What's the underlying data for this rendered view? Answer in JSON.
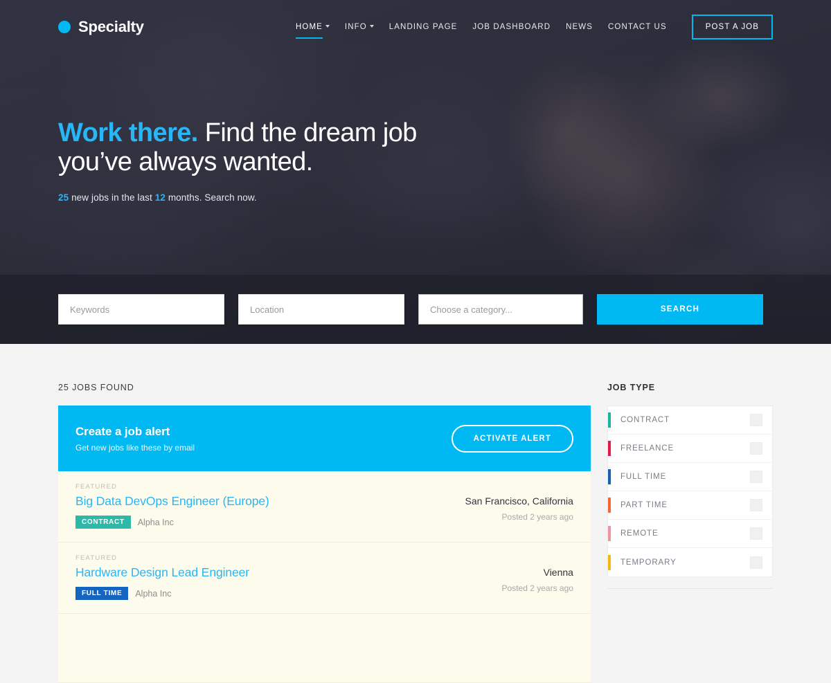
{
  "header": {
    "logo_text": "Specialty",
    "nav": [
      {
        "label": "HOME",
        "has_caret": true,
        "active": true
      },
      {
        "label": "INFO",
        "has_caret": true,
        "active": false
      },
      {
        "label": "LANDING PAGE",
        "has_caret": false,
        "active": false
      },
      {
        "label": "JOB DASHBOARD",
        "has_caret": false,
        "active": false
      },
      {
        "label": "NEWS",
        "has_caret": false,
        "active": false
      },
      {
        "label": "CONTACT US",
        "has_caret": false,
        "active": false
      }
    ],
    "post_job_label": "POST A JOB"
  },
  "hero": {
    "title_accent": "Work there.",
    "title_rest": " Find the dream job you’ve always wanted.",
    "sub_count": "25",
    "sub_mid": " new jobs in the last ",
    "sub_months": "12",
    "sub_end": " months. Search now."
  },
  "search": {
    "keywords_placeholder": "Keywords",
    "location_placeholder": "Location",
    "category_placeholder": "Choose a category...",
    "button_label": "SEARCH"
  },
  "results": {
    "count_label": "25 JOBS FOUND",
    "alert": {
      "title": "Create a job alert",
      "subtitle": "Get new jobs like these by email",
      "button_label": "ACTIVATE ALERT"
    },
    "jobs": [
      {
        "flag": "FEATURED",
        "title": "Big Data DevOps Engineer (Europe)",
        "badge": "CONTRACT",
        "badge_color": "#2cb9a8",
        "company": "Alpha Inc",
        "location": "San Francisco, California",
        "posted": "Posted 2 years ago"
      },
      {
        "flag": "FEATURED",
        "title": "Hardware Design Lead Engineer",
        "badge": "FULL TIME",
        "badge_color": "#1565c0",
        "company": "Alpha Inc",
        "location": "Vienna",
        "posted": "Posted 2 years ago"
      }
    ]
  },
  "sidebar": {
    "title": "JOB TYPE",
    "filters": [
      {
        "label": "CONTRACT",
        "color": "#19b5a0"
      },
      {
        "label": "FREELANCE",
        "color": "#e8174f"
      },
      {
        "label": "FULL TIME",
        "color": "#1461b8"
      },
      {
        "label": "PART TIME",
        "color": "#f4673b"
      },
      {
        "label": "REMOTE",
        "color": "#ef94a0"
      },
      {
        "label": "TEMPORARY",
        "color": "#f2b816"
      }
    ]
  },
  "theme": {
    "accent": "#00b9f2",
    "hero_bg": "#2a2b38",
    "featured_bg": "#fdfbec",
    "page_bg": "#f4f4f4"
  }
}
